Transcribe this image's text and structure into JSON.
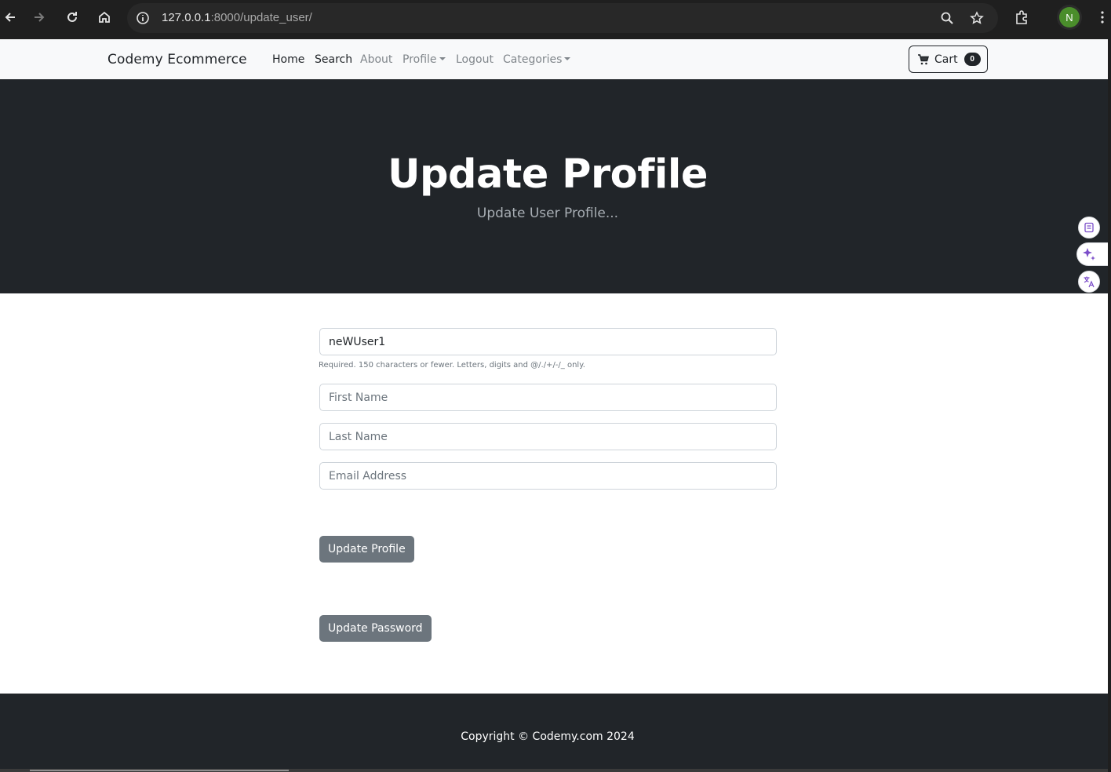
{
  "browser": {
    "url_host": "127.0.0.1",
    "url_rest": ":8000/update_user/",
    "profile_initial": "N"
  },
  "navbar": {
    "brand": "Codemy Ecommerce",
    "links": [
      "Home",
      "Search",
      "About",
      "Profile",
      "Logout",
      "Categories"
    ],
    "cart_label": "Cart",
    "cart_count": "0"
  },
  "header": {
    "title": "Update Profile",
    "subtitle": "Update User Profile..."
  },
  "form": {
    "username_value": "neWUser1",
    "username_help": "Required. 150 characters or fewer. Letters, digits and @/./+/-/_ only.",
    "first_name_placeholder": "First Name",
    "last_name_placeholder": "Last Name",
    "email_placeholder": "Email Address",
    "update_profile_button": "Update Profile",
    "update_password_button": "Update Password"
  },
  "footer": {
    "copyright": "Copyright © Codemy.com 2024"
  },
  "colors": {
    "dark": "#212529",
    "secondary_button": "#6c757d",
    "navbar_bg": "#f8f9fa"
  }
}
